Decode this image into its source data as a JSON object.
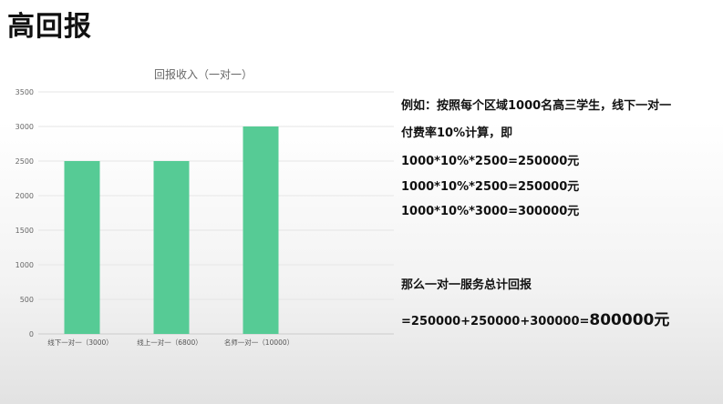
{
  "slide": {
    "title": "高回报"
  },
  "chart_data": {
    "type": "bar",
    "title": "回报收入（一对一）",
    "categories": [
      "线下一对一（3000）",
      "线上一对一（6800）",
      "名师一对一（10000）"
    ],
    "values": [
      2500,
      2500,
      3000
    ],
    "ylim": [
      0,
      3500
    ],
    "yticks": [
      "0",
      "500",
      "1000",
      "1500",
      "2000",
      "2500",
      "3000",
      "3500"
    ],
    "xlabel": "",
    "ylabel": "",
    "grid": true,
    "color": "#56cb95"
  },
  "explanation": {
    "line1": "例如：按照每个区域1000名高三学生，线下一对一",
    "line2": "付费率10%计算，即",
    "calc1": "1000*10%*2500=250000元",
    "calc2": "1000*10%*2500=250000元",
    "calc3": "1000*10%*3000=300000元",
    "summary": "那么一对一服务总计回报",
    "total_prefix": "=250000+250000+300000=",
    "total_value": "800000",
    "total_unit": "元"
  }
}
